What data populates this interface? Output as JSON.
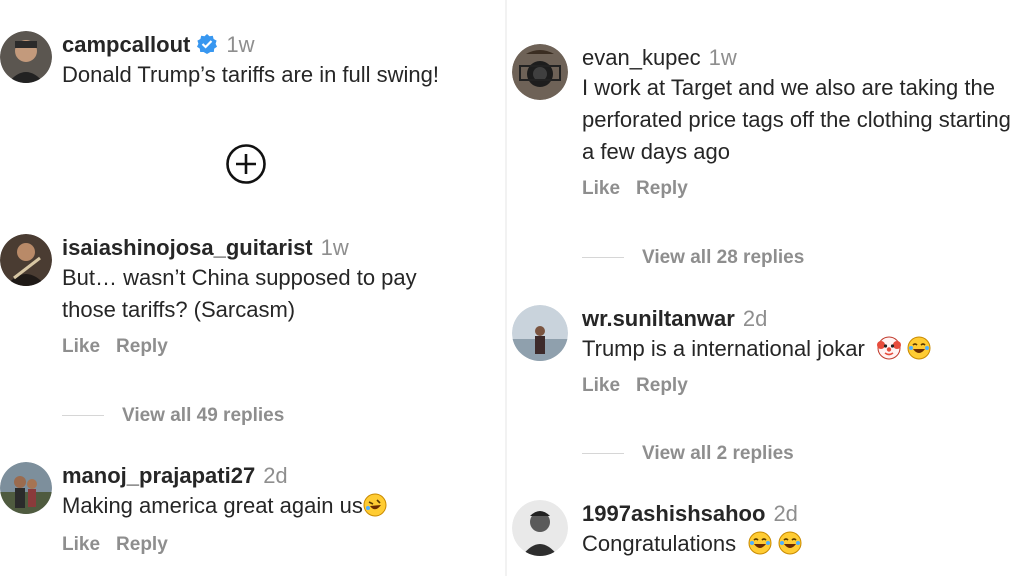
{
  "left": {
    "comments": [
      {
        "username": "campcallout",
        "time": "1w",
        "text": "Donald Trump’s tariffs are in full swing!"
      },
      {
        "username": "isaiashinojosa_guitarist",
        "time": "1w",
        "text": "But… wasn’t China supposed to pay those tariffs? (Sarcasm)",
        "like": "Like",
        "reply": "Reply",
        "view_replies": "View all 49 replies"
      },
      {
        "username": "manoj_prajapati27",
        "time": "2d",
        "text": "Making america great again us",
        "like": "Like",
        "reply": "Reply"
      }
    ]
  },
  "right": {
    "comments": [
      {
        "username": "evan_kupec",
        "time": "1w",
        "text": "I work at Target and we also are taking the perforated price tags off the clothing starting a few days ago",
        "like": "Like",
        "reply": "Reply",
        "view_replies": "View all 28 replies"
      },
      {
        "username": "wr.suniltanwar",
        "time": "2d",
        "text": "Trump is a international jokar",
        "like": "Like",
        "reply": "Reply",
        "view_replies": "View all 2 replies"
      },
      {
        "username": "1997ashishsahoo",
        "time": "2d",
        "text": "Congratulations"
      }
    ]
  },
  "icons": {
    "verified": "verified-badge-icon",
    "add": "plus-circle-icon",
    "rofl": "rolling-laughing-emoji",
    "joy": "tears-of-joy-emoji",
    "clown": "clown-face-emoji"
  },
  "colors": {
    "verified": "#3897f0",
    "secondary": "#8e8e8e",
    "text": "#262626"
  }
}
